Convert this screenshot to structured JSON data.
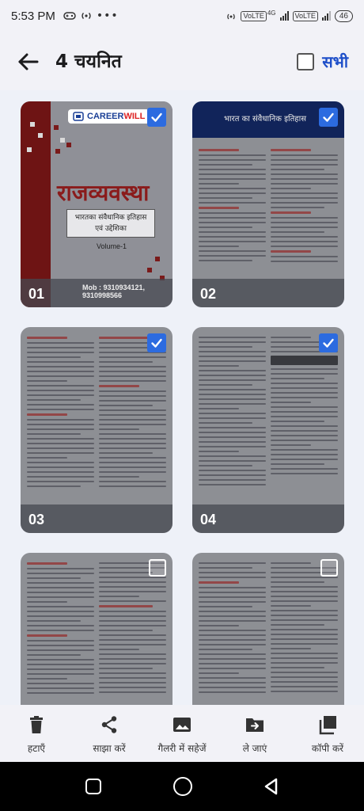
{
  "status_bar": {
    "time": "5:53 PM",
    "dots": "•••",
    "sim1": "VoLTE",
    "sim1_net": "4G",
    "sim2": "VoLTE",
    "battery": "46"
  },
  "header": {
    "title": "4 चयनित",
    "select_all_label": "सभी",
    "select_all_checked": false
  },
  "thumbnails": [
    {
      "number": "01",
      "selected": true
    },
    {
      "number": "02",
      "selected": true
    },
    {
      "number": "03",
      "selected": true
    },
    {
      "number": "04",
      "selected": true
    },
    {
      "number": "",
      "selected": false
    },
    {
      "number": "",
      "selected": false
    }
  ],
  "cover": {
    "logo": "CAREERWILL",
    "logo_part1": "CAREER",
    "logo_part2": "WILL",
    "title": "राजव्यवस्था",
    "subtitle_line1": "भारतका संवैधानिक इतिहास",
    "subtitle_line2": "एवं उद्देशिका",
    "volume": "Volume-1",
    "mobile": "Mob : 9310934121, 9310998566"
  },
  "page2": {
    "header_title": "भारत का संवैधानिक इतिहास"
  },
  "actions": [
    {
      "label": "हटाएँ",
      "icon": "trash-icon"
    },
    {
      "label": "साझा करें",
      "icon": "share-icon"
    },
    {
      "label": "गैलरी में सहेजें",
      "icon": "gallery-icon"
    },
    {
      "label": "ले जाएं",
      "icon": "move-folder-icon"
    },
    {
      "label": "कॉपी करें",
      "icon": "copy-icon"
    }
  ],
  "colors": {
    "accent": "#2c6be0",
    "select_all_text": "#1e4fc9",
    "cover_red": "#8a1b1b",
    "header_bg": "#f2f2f7"
  }
}
